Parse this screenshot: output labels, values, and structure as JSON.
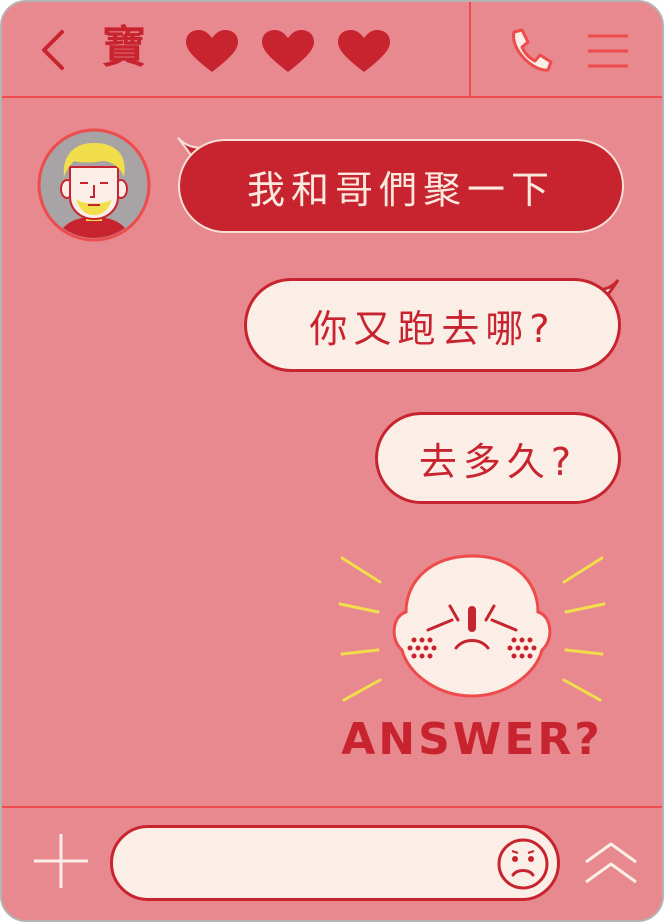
{
  "header": {
    "title": "寶",
    "icons": [
      "back-chevron-icon",
      "heart-icon",
      "heart-icon",
      "heart-icon",
      "phone-icon",
      "menu-icon"
    ]
  },
  "messages": [
    {
      "direction": "incoming",
      "text": "我和哥們聚一下"
    },
    {
      "direction": "outgoing",
      "text": "你又跑去哪?"
    },
    {
      "direction": "outgoing",
      "text": "去多久?"
    }
  ],
  "sticker": {
    "label": "ANSWER?",
    "icon": "angry-face-icon"
  },
  "composer": {
    "value": "",
    "placeholder": "",
    "icons": [
      "plus-icon",
      "sad-face-icon",
      "double-chevron-up-icon"
    ]
  },
  "colors": {
    "background": "#e8888f",
    "accent": "#c8242f",
    "line": "#ee4b4d",
    "bubble_light": "#fbeee6",
    "ray_yellow": "#f2de4a"
  }
}
